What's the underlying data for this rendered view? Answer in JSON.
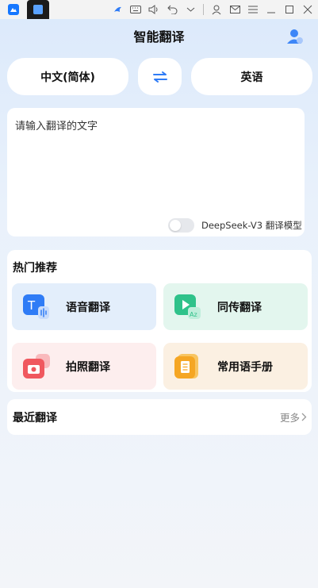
{
  "header": {
    "title": "智能翻译"
  },
  "languages": {
    "source": "中文(简体)",
    "target": "英语"
  },
  "input": {
    "placeholder": "请输入翻译的文字",
    "value": ""
  },
  "model_toggle": {
    "label": "DeepSeek-V3 翻译模型",
    "enabled": false
  },
  "hot": {
    "title": "热门推荐",
    "items": [
      {
        "label": "语音翻译",
        "icon": "voice-translate-icon",
        "color": "#2f7cf6"
      },
      {
        "label": "同传翻译",
        "icon": "simultaneous-translate-icon",
        "color": "#2fc28a"
      },
      {
        "label": "拍照翻译",
        "icon": "camera-translate-icon",
        "color": "#f0585f"
      },
      {
        "label": "常用语手册",
        "icon": "phrasebook-icon",
        "color": "#f5a623"
      }
    ]
  },
  "recent": {
    "title": "最近翻译",
    "more_label": "更多"
  },
  "colors": {
    "accent": "#2f7cf6",
    "background": "#e6effa"
  }
}
